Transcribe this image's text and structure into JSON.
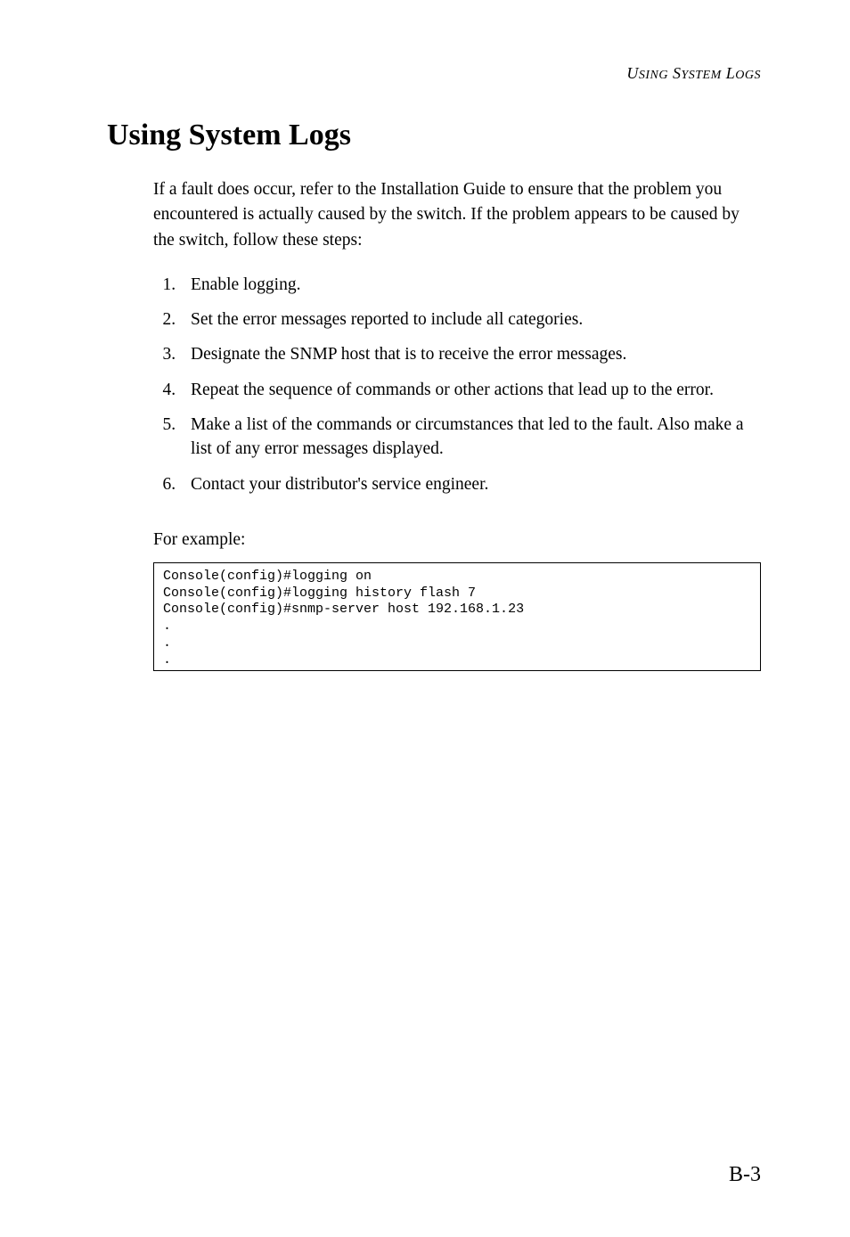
{
  "header": {
    "running_title": "USING SYSTEM LOGS"
  },
  "title": "Using System Logs",
  "intro": "If a fault does occur, refer to the Installation Guide to ensure that the problem you encountered is actually caused by the switch. If the problem appears to be caused by the switch, follow these steps:",
  "steps": [
    "Enable logging.",
    "Set the error messages reported to include all categories.",
    "Designate the SNMP host that is to receive the error messages.",
    "Repeat the sequence of commands or other actions that lead up to the error.",
    "Make a list of the commands or circumstances that led to the fault. Also make a list of any error messages displayed.",
    "Contact your distributor's service engineer."
  ],
  "example_label": "For example:",
  "code_lines": [
    "Console(config)#logging on",
    "Console(config)#logging history flash 7",
    "Console(config)#snmp-server host 192.168.1.23"
  ],
  "page_number": "B-3"
}
